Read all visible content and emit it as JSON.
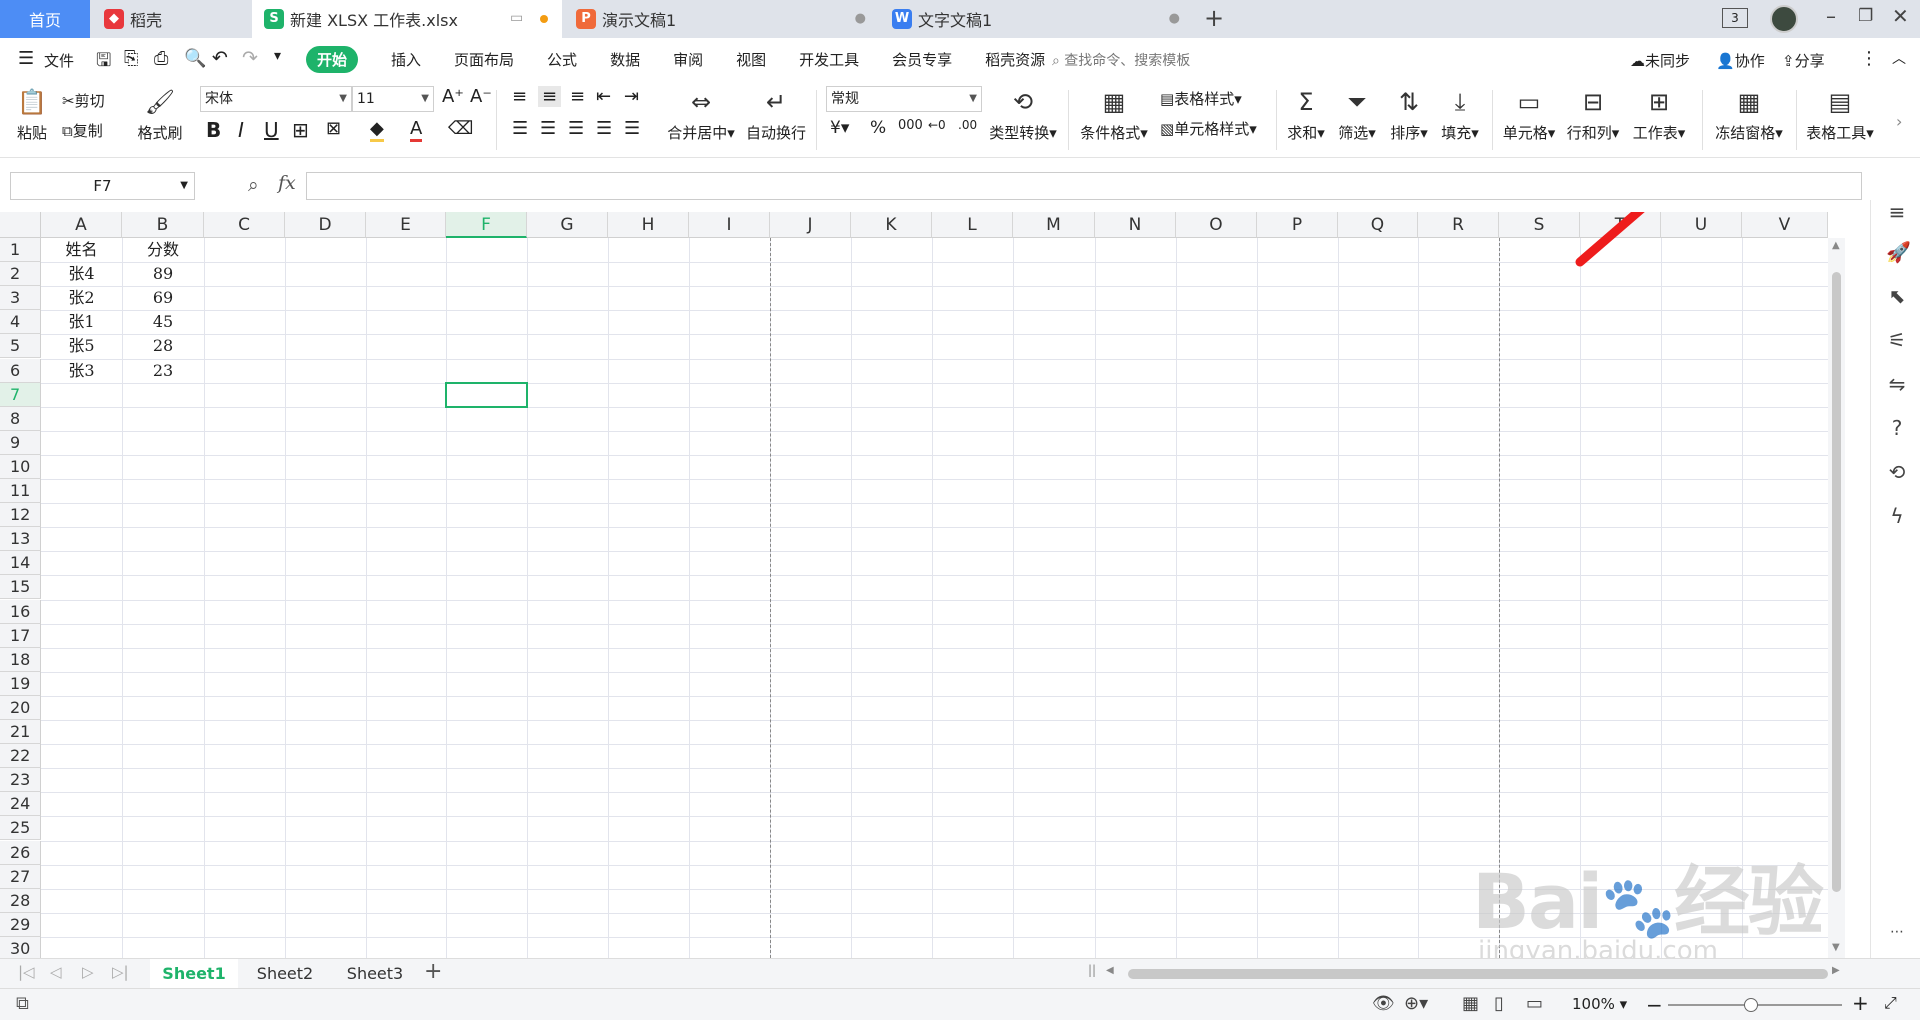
{
  "tabs": [
    {
      "label": "首页"
    },
    {
      "label": "稻壳"
    },
    {
      "label": "新建 XLSX 工作表.xlsx"
    },
    {
      "label": "演示文稿1"
    },
    {
      "label": "文字文稿1"
    }
  ],
  "window": {
    "count_badge": "3"
  },
  "menu": {
    "file": "文件",
    "items": [
      "开始",
      "插入",
      "页面布局",
      "公式",
      "数据",
      "审阅",
      "视图",
      "开发工具",
      "会员专享",
      "稻壳资源"
    ],
    "search_placeholder": "查找命令、搜索模板",
    "sync": "未同步",
    "collab": "协作",
    "share": "分享"
  },
  "ribbon": {
    "paste": "粘贴",
    "cut": "剪切",
    "copy": "复制",
    "format_painter": "格式刷",
    "font_name": "宋体",
    "font_size": "11",
    "merge_center": "合并居中",
    "auto_wrap": "自动换行",
    "number_format": "常规",
    "type_convert": "类型转换",
    "cond_format": "条件格式",
    "table_style": "表格样式",
    "cell_style": "单元格样式",
    "sum": "求和",
    "filter": "筛选",
    "sort": "排序",
    "fill": "填充",
    "cell": "单元格",
    "row_col": "行和列",
    "worksheet": "工作表",
    "freeze": "冻结窗格",
    "table_tools": "表格工具"
  },
  "formula_bar": {
    "name_box": "F7",
    "fx": "fx",
    "value": ""
  },
  "grid": {
    "columns": [
      "A",
      "B",
      "C",
      "D",
      "E",
      "F",
      "G",
      "H",
      "I",
      "J",
      "K",
      "L",
      "M",
      "N",
      "O",
      "P",
      "Q",
      "R",
      "S",
      "T",
      "U",
      "V"
    ],
    "rows": [
      "1",
      "2",
      "3",
      "4",
      "5",
      "6",
      "7",
      "8",
      "9",
      "10",
      "11",
      "12",
      "13",
      "14",
      "15",
      "16",
      "17",
      "18",
      "19",
      "20",
      "21",
      "22",
      "23",
      "24",
      "25",
      "26",
      "27",
      "28",
      "29",
      "30"
    ],
    "selected_cell": "F7",
    "data": [
      [
        "姓名",
        "分数"
      ],
      [
        "张4",
        "89"
      ],
      [
        "张2",
        "69"
      ],
      [
        "张1",
        "45"
      ],
      [
        "张5",
        "28"
      ],
      [
        "张3",
        "23"
      ]
    ]
  },
  "sheets": [
    "Sheet1",
    "Sheet2",
    "Sheet3"
  ],
  "active_sheet": "Sheet1",
  "status": {
    "zoom": "100%"
  },
  "watermark": {
    "text1": "Bai",
    "text2": "经验",
    "url": "jingyan.baidu.com"
  }
}
